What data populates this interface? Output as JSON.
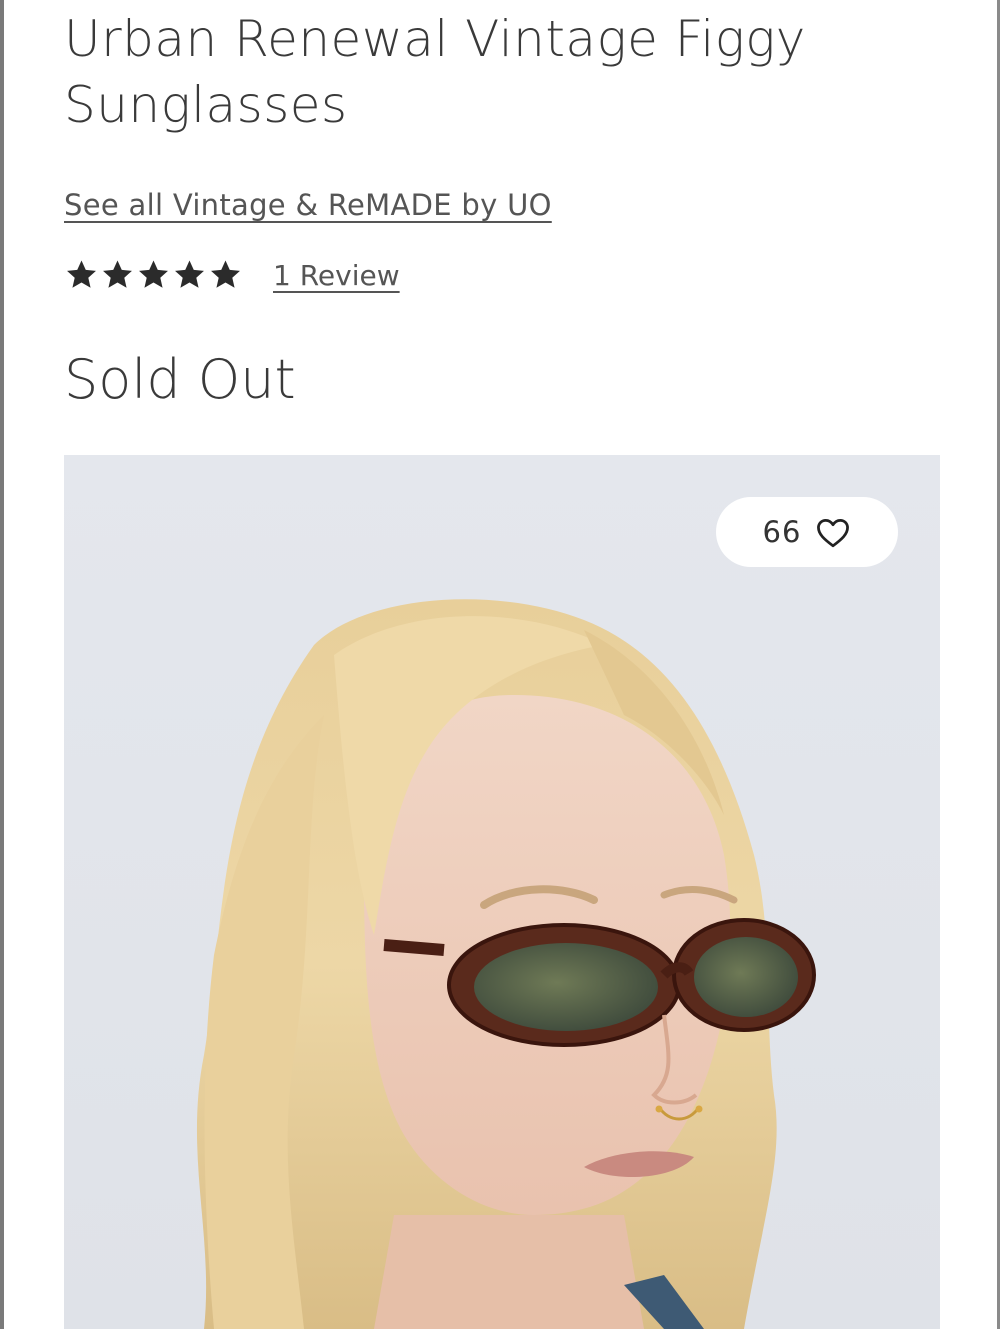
{
  "product": {
    "title": "Urban Renewal Vintage Figgy Sunglasses",
    "brand_link": "See all Vintage & ReMADE by UO",
    "rating": {
      "stars": 5,
      "max": 5
    },
    "review_link": "1 Review",
    "price_status": "Sold Out"
  },
  "gallery": {
    "like_count": "66",
    "icons": {
      "favorite": "heart-outline-icon",
      "rating": "star-icon"
    }
  },
  "colors": {
    "text": "#3a3a3a",
    "image_background": "#e3e6ec"
  }
}
